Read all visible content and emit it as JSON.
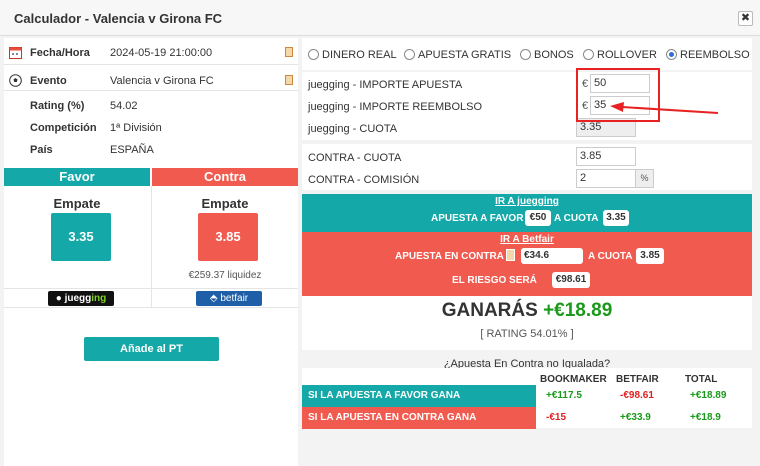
{
  "window": {
    "title": "Calculador - Valencia v Girona FC",
    "close_label": "✖"
  },
  "event_info": [
    {
      "label": "Fecha/Hora",
      "value": "2024-05-19 21:00:00",
      "icon": "calendar-icon"
    },
    {
      "label": "Evento",
      "value": "Valencia v Girona FC",
      "icon": "soccer-ball-icon"
    },
    {
      "label": "Rating (%)",
      "value": "54.02"
    },
    {
      "label": "Competición",
      "value": "1ª División"
    },
    {
      "label": "País",
      "value": "ESPAÑA"
    }
  ],
  "favor": {
    "header": "Favor",
    "selection": "Empate",
    "odds": "3.35",
    "color": "#14a8a8",
    "bookmaker_logo": "juegging"
  },
  "contra": {
    "header": "Contra",
    "selection": "Empate",
    "odds": "3.85",
    "liquidity": "€259.37 liquidez",
    "color": "#f05a4f",
    "exchange_logo": "betfair"
  },
  "add_button": "Añade al PT",
  "modes": [
    {
      "label": "DINERO REAL",
      "selected": false
    },
    {
      "label": "APUESTA GRATIS",
      "selected": false
    },
    {
      "label": "BONOS",
      "selected": false
    },
    {
      "label": "ROLLOVER",
      "selected": false
    },
    {
      "label": "REEMBOLSO",
      "selected": true
    }
  ],
  "fields": {
    "importe_apuesta": {
      "label": "juegging - IMPORTE APUESTA",
      "currency": "€",
      "value": "50"
    },
    "importe_reembolso": {
      "label": "juegging - IMPORTE REEMBOLSO",
      "currency": "€",
      "value": "35"
    },
    "cuota": {
      "label": "juegging - CUOTA",
      "value": "3.35"
    },
    "contra_cuota": {
      "label": "CONTRA - CUOTA",
      "value": "3.85"
    },
    "contra_comision": {
      "label": "CONTRA - COMISIÓN",
      "value": "2",
      "unit": "%"
    }
  },
  "favor_band": {
    "link": "IR A juegging",
    "text_stake": "APUESTA A FAVOR",
    "stake": "€50",
    "text_odds": "A CUOTA",
    "odds": "3.35"
  },
  "contra_band": {
    "link": "IR A Betfair",
    "text_stake": "APUESTA EN CONTRA",
    "stake": "€34.6",
    "text_odds": "A CUOTA",
    "odds": "3.85",
    "risk_text": "EL RIESGO SERÁ",
    "risk": "€98.61"
  },
  "result": {
    "label": "GANARÁS",
    "amount": "+€18.89",
    "rating": "[ RATING 54.01% ]",
    "unmatched_link": "¿Apuesta En Contra no Igualada?"
  },
  "table": {
    "headers": [
      "BOOKMAKER",
      "BETFAIR",
      "TOTAL"
    ],
    "rows": [
      {
        "label": "SI LA APUESTA A FAVOR GANA",
        "bookmaker": "+€117.5",
        "betfair": "-€98.61",
        "total": "+€18.89"
      },
      {
        "label": "SI LA APUESTA EN CONTRA GANA",
        "bookmaker": "-€15",
        "betfair": "+€33.9",
        "total": "+€18.9"
      }
    ]
  }
}
